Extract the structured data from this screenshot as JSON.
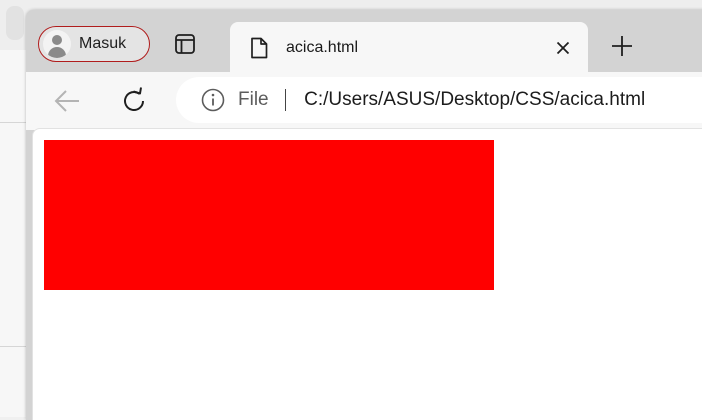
{
  "profile": {
    "label": "Masuk"
  },
  "tab": {
    "title": "acica.html"
  },
  "omnibox": {
    "scheme_label": "File",
    "url": "C:/Users/ASUS/Desktop/CSS/acica.html"
  },
  "page": {
    "box_color": "#ff0000"
  },
  "colors": {
    "profile_border": "#b01c1c",
    "tabstrip": "#d3d3d3",
    "toolbar": "#f7f7f7"
  },
  "icons": {
    "profile": "avatar-icon",
    "tab_actions": "tab-actions-icon",
    "favicon": "file-icon",
    "close": "close-icon",
    "new_tab": "plus-icon",
    "back": "back-arrow-icon",
    "reload": "reload-icon",
    "info": "info-icon"
  }
}
